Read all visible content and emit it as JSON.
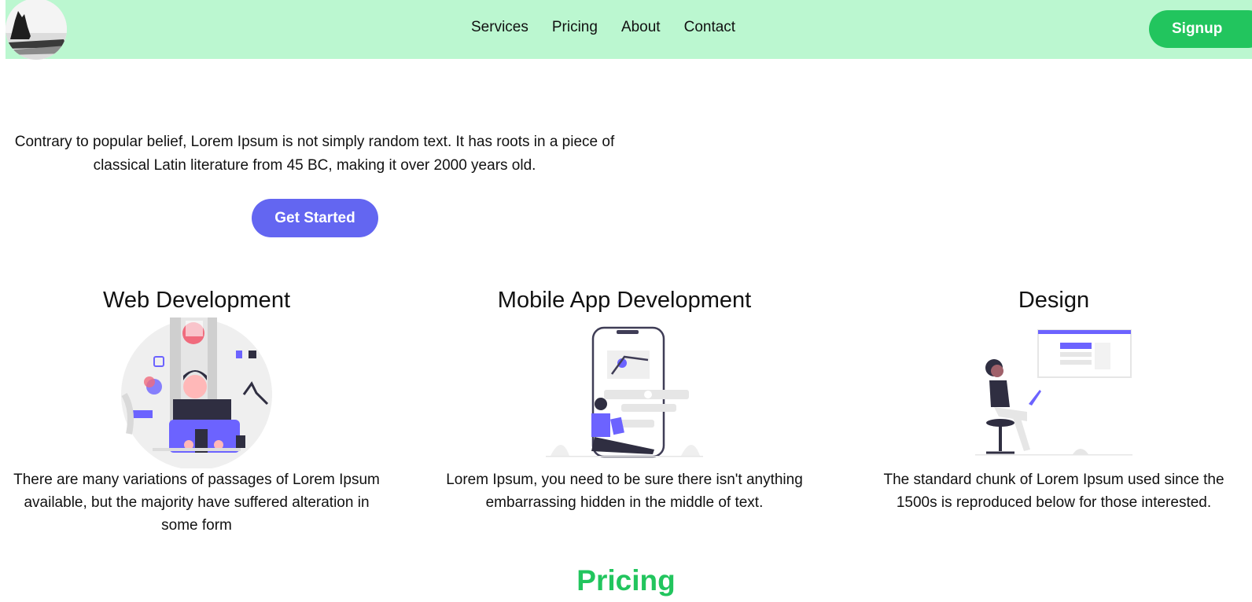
{
  "nav": {
    "links": [
      "Services",
      "Pricing",
      "About",
      "Contact"
    ],
    "signup_label": "Signup"
  },
  "hero": {
    "text": "Contrary to popular belief, Lorem Ipsum is not simply random text. It has roots in a piece of classical Latin literature from 45 BC, making it over 2000 years old.",
    "cta_label": "Get Started"
  },
  "services": [
    {
      "title": "Web Development",
      "description": "There are many variations of passages of Lorem Ipsum available, but the majority have suffered alteration in some form"
    },
    {
      "title": "Mobile App Development",
      "description": "Lorem Ipsum, you need to be sure there isn't anything embarrassing hidden in the middle of text."
    },
    {
      "title": "Design",
      "description": "The standard chunk of Lorem Ipsum used since the 1500s is reproduced below for those interested."
    }
  ],
  "pricing": {
    "title": "Pricing"
  },
  "colors": {
    "navbar_bg": "#bbf7d0",
    "signup_bg": "#22c55e",
    "cta_bg": "#6366f1",
    "pricing_title": "#22c55e"
  }
}
